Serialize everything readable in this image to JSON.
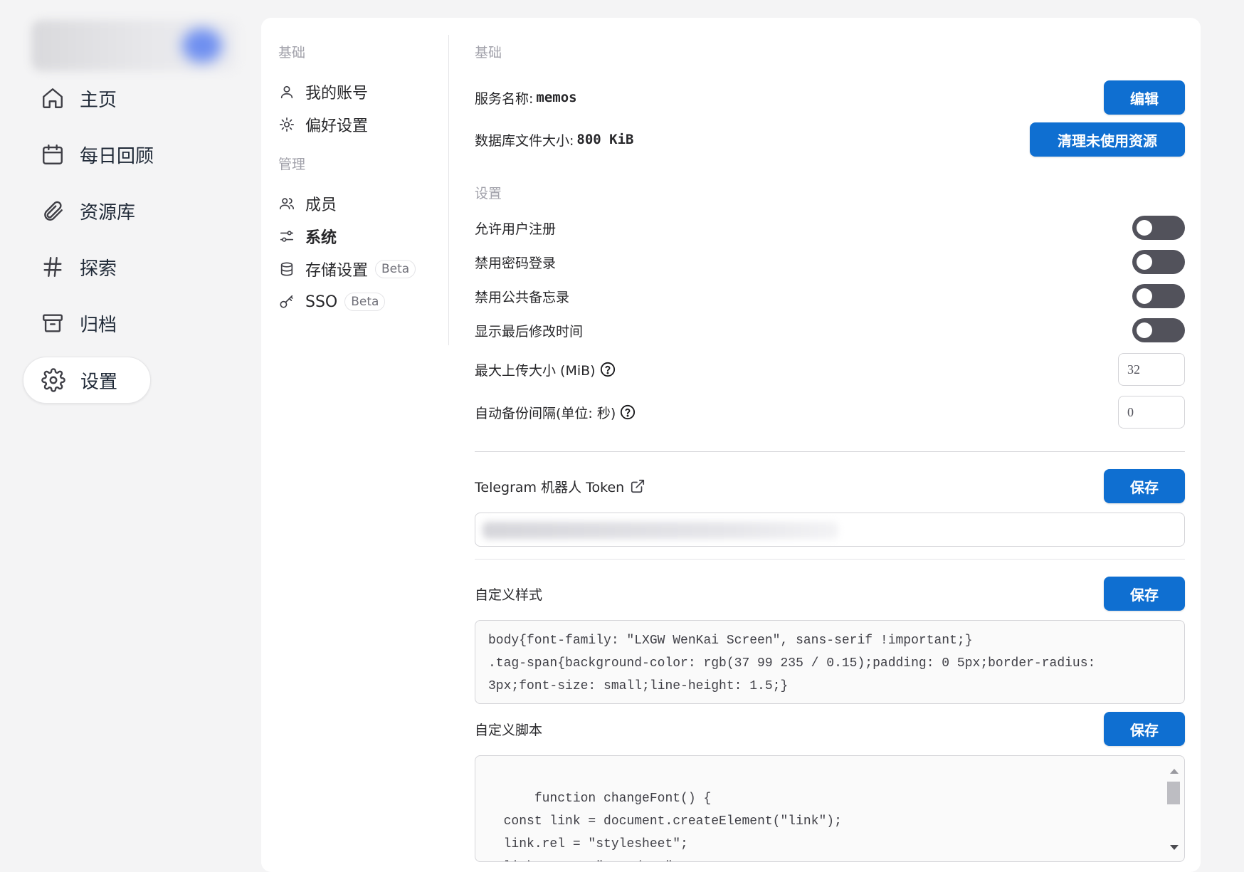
{
  "nav": {
    "items": [
      {
        "label": "主页",
        "icon": "home-icon"
      },
      {
        "label": "每日回顾",
        "icon": "calendar-icon"
      },
      {
        "label": "资源库",
        "icon": "paperclip-icon"
      },
      {
        "label": "探索",
        "icon": "hash-icon"
      },
      {
        "label": "归档",
        "icon": "archive-icon"
      },
      {
        "label": "设置",
        "icon": "gear-icon",
        "active": true
      }
    ]
  },
  "subnav": {
    "basic_title": "基础",
    "my_account": "我的账号",
    "preferences": "偏好设置",
    "admin_title": "管理",
    "members": "成员",
    "system": "系统",
    "storage": "存储设置",
    "storage_badge": "Beta",
    "sso": "SSO",
    "sso_badge": "Beta"
  },
  "system": {
    "basic_title": "基础",
    "service_name_label": "服务名称:",
    "service_name_value": "memos",
    "edit_button": "编辑",
    "db_size_label": "数据库文件大小:",
    "db_size_value": "800 KiB",
    "cleanup_button": "清理未使用资源",
    "settings_title": "设置",
    "allow_signup": "允许用户注册",
    "disable_password_login": "禁用密码登录",
    "disable_public_memos": "禁用公共备忘录",
    "show_last_modified": "显示最后修改时间",
    "max_upload_label": "最大上传大小 (MiB)",
    "max_upload_value": "32",
    "backup_interval_label": "自动备份间隔(单位: 秒)",
    "backup_interval_value": "0",
    "telegram_label": "Telegram 机器人 Token",
    "save_button": "保存",
    "custom_style_label": "自定义样式",
    "custom_style_code": "body{font-family: \"LXGW WenKai Screen\", sans-serif !important;}\n.tag-span{background-color: rgb(37 99 235 / 0.15);padding: 0 5px;border-radius: 3px;font-size: small;line-height: 1.5;}",
    "custom_script_label": "自定义脚本",
    "custom_script_code": "function changeFont() {\n  const link = document.createElement(\"link\");\n  link.rel = \"stylesheet\";\n  link.type = \"text/css\";"
  },
  "colors": {
    "accent": "#0f6fd1",
    "toggle_off": "#52525b",
    "background": "#f4f4f5"
  }
}
